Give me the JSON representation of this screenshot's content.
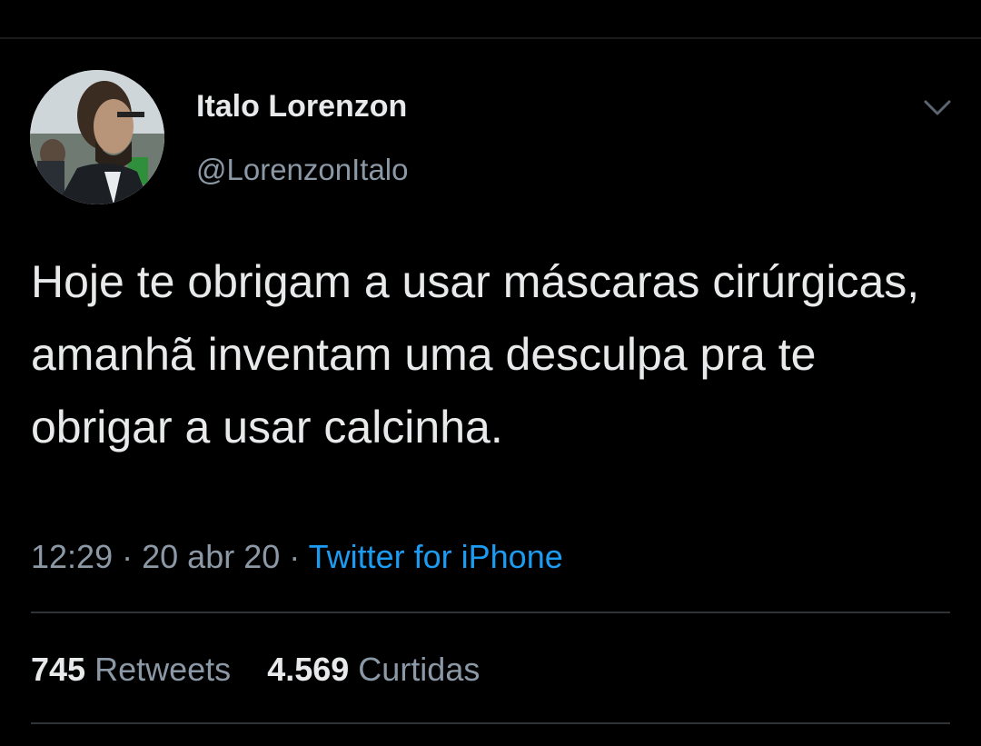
{
  "tweet": {
    "author": {
      "display_name": "Italo Lorenzon",
      "handle": "@LorenzonItalo",
      "avatar_icon": "profile-photo"
    },
    "menu_icon": "chevron-down-icon",
    "text": "Hoje te obrigam a usar máscaras cirúrgicas, amanhã inventam uma desculpa pra te obrigar a usar calcinha.",
    "time": "12:29",
    "date": "20 abr 20",
    "separator": "·",
    "source": "Twitter for iPhone",
    "stats": {
      "retweets_count": "745",
      "retweets_label": "Retweets",
      "likes_count": "4.569",
      "likes_label": "Curtidas"
    }
  },
  "colors": {
    "background": "#000000",
    "primary_text": "#e7e9ea",
    "secondary_text": "#8b98a5",
    "link": "#1d9bf0",
    "divider": "#2f3336"
  }
}
